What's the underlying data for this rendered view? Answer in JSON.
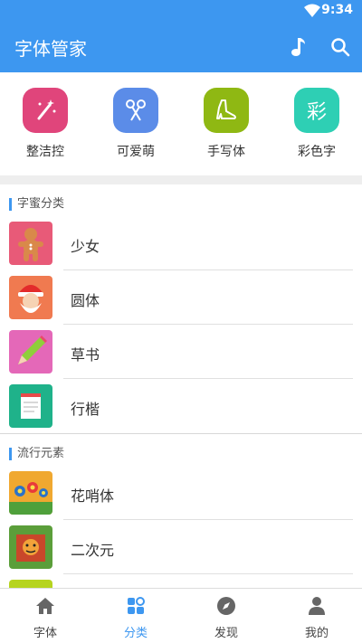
{
  "status": {
    "time": "9:34"
  },
  "appbar": {
    "title": "字体管家"
  },
  "quick": [
    {
      "label": "整洁控",
      "color": "#e0457b"
    },
    {
      "label": "可爱萌",
      "color": "#5b8ce8"
    },
    {
      "label": "手写体",
      "color": "#8fb813"
    },
    {
      "label": "彩色字",
      "color": "#2ecfb4",
      "glyph": "彩"
    }
  ],
  "sections": [
    {
      "title": "字蜜分类",
      "items": [
        "少女",
        "圆体",
        "草书",
        "行楷"
      ]
    },
    {
      "title": "流行元素",
      "items": [
        "花哨体",
        "二次元"
      ]
    }
  ],
  "tabs": [
    {
      "label": "字体",
      "active": false
    },
    {
      "label": "分类",
      "active": true
    },
    {
      "label": "发现",
      "active": false
    },
    {
      "label": "我的",
      "active": false
    }
  ],
  "colors": {
    "primary": "#3d97f0"
  }
}
